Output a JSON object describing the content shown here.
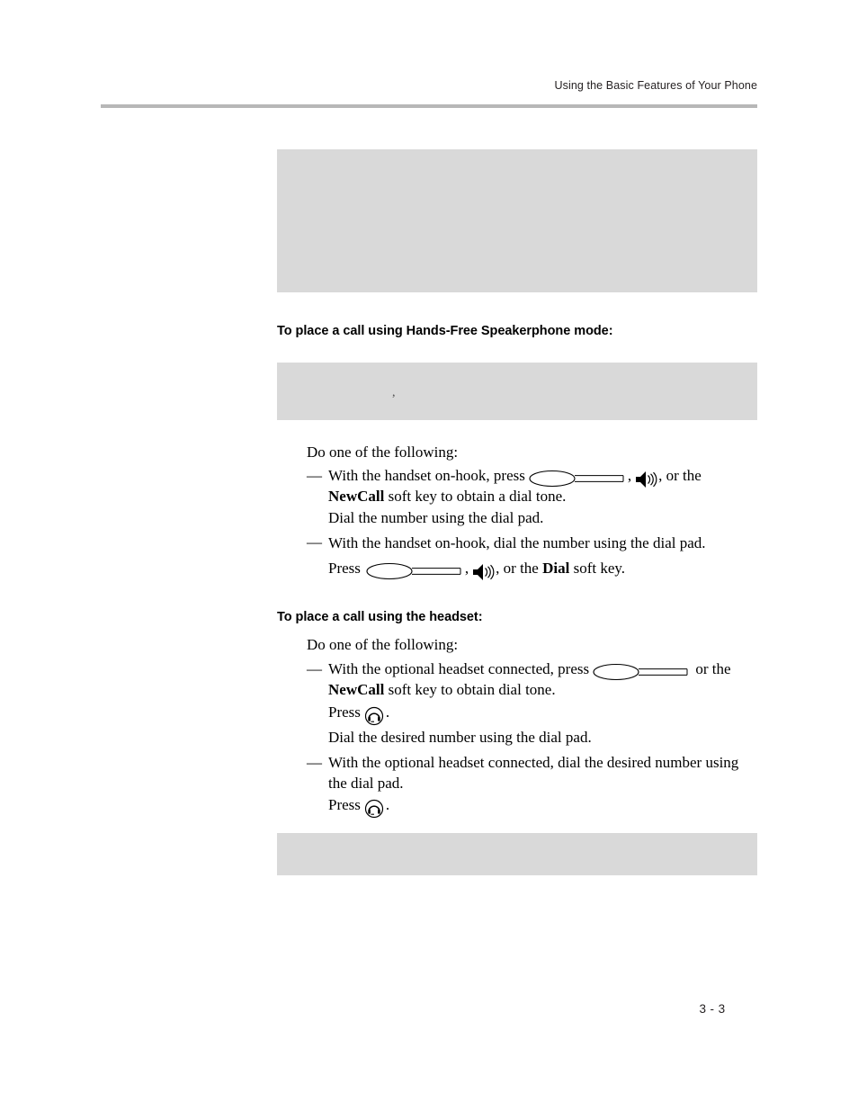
{
  "page": {
    "running_header": "Using the Basic Features of Your Phone",
    "page_number": "3 - 3"
  },
  "figures": {
    "top_placeholder_alt": "",
    "mid_placeholder_artifact": ",",
    "bottom_placeholder_alt": ""
  },
  "sections": {
    "speakerphone": {
      "heading": "To place a call using Hands-Free Speakerphone mode:",
      "lead": "Do one of the following:",
      "bullets": [
        {
          "dash": "—",
          "text_before_icon": "With the handset on-hook, press",
          "comma": ",",
          "text_after_icons": ", or the",
          "continuation_bold": "NewCall",
          "continuation_rest": " soft key to obtain a dial tone.",
          "sub_line": "Dial the number using the dial pad."
        },
        {
          "dash": "—",
          "text": "With the handset on-hook, dial the number using the dial pad.",
          "press_label": "Press",
          "comma": ",",
          "press_after": ", or the",
          "press_bold": "Dial",
          "press_tail": " soft key."
        }
      ]
    },
    "headset": {
      "heading": "To place a call using the headset:",
      "lead": "Do one of the following:",
      "bullets": [
        {
          "dash": "—",
          "text_before_icon": "With the optional headset connected, press",
          "text_after_icon": "or the",
          "continuation_bold": "NewCall",
          "continuation_rest": " soft key to obtain dial tone.",
          "press_label": "Press",
          "press_tail": ".",
          "sub_line": "Dial the desired number using the dial pad."
        },
        {
          "dash": "—",
          "text": "With the optional headset connected, dial the desired number using the dial pad.",
          "press_label": "Press",
          "press_tail": "."
        }
      ]
    }
  },
  "icons": {
    "line_key": "line-key-icon",
    "speaker": "speakerphone-icon",
    "headset": "headset-icon"
  },
  "colors": {
    "figure_gray": "#d9d9d9",
    "rule_gray": "#b7b7b7",
    "text": "#000000"
  }
}
